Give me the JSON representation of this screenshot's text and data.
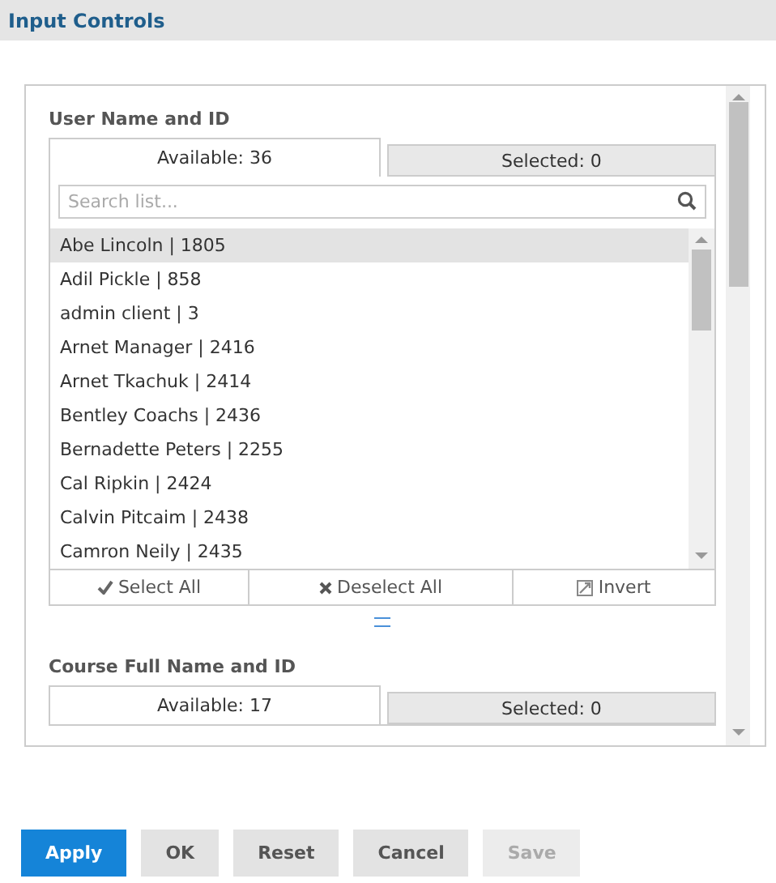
{
  "header": {
    "title": "Input Controls"
  },
  "controls": [
    {
      "label": "User Name and ID",
      "tabs": [
        {
          "label": "Available: 36",
          "selected": true
        },
        {
          "label": "Selected: 0",
          "selected": false
        }
      ],
      "search": {
        "placeholder": "Search list..."
      },
      "items": [
        {
          "label": "Abe Lincoln | 1805",
          "selected": true
        },
        {
          "label": "Adil Pickle | 858",
          "selected": false
        },
        {
          "label": "admin client | 3",
          "selected": false
        },
        {
          "label": "Arnet Manager | 2416",
          "selected": false
        },
        {
          "label": "Arnet Tkachuk | 2414",
          "selected": false
        },
        {
          "label": "Bentley Coachs | 2436",
          "selected": false
        },
        {
          "label": "Bernadette Peters | 2255",
          "selected": false
        },
        {
          "label": "Cal Ripkin | 2424",
          "selected": false
        },
        {
          "label": "Calvin Pitcaim | 2438",
          "selected": false
        },
        {
          "label": "Camron Neily | 2435",
          "selected": false
        }
      ],
      "actions": [
        {
          "label": "Select All",
          "kind": "check"
        },
        {
          "label": "Deselect All",
          "kind": "cross"
        },
        {
          "label": "Invert",
          "kind": "invert"
        }
      ]
    },
    {
      "label": "Course Full Name and ID",
      "tabs": [
        {
          "label": "Available: 17",
          "selected": true
        },
        {
          "label": "Selected: 0",
          "selected": false
        }
      ]
    }
  ],
  "buttons": [
    {
      "label": "Apply",
      "kind": "primary",
      "disabled": false
    },
    {
      "label": "OK",
      "kind": "default",
      "disabled": false
    },
    {
      "label": "Reset",
      "kind": "default",
      "disabled": false
    },
    {
      "label": "Cancel",
      "kind": "default",
      "disabled": false
    },
    {
      "label": "Save",
      "kind": "default",
      "disabled": true
    }
  ]
}
